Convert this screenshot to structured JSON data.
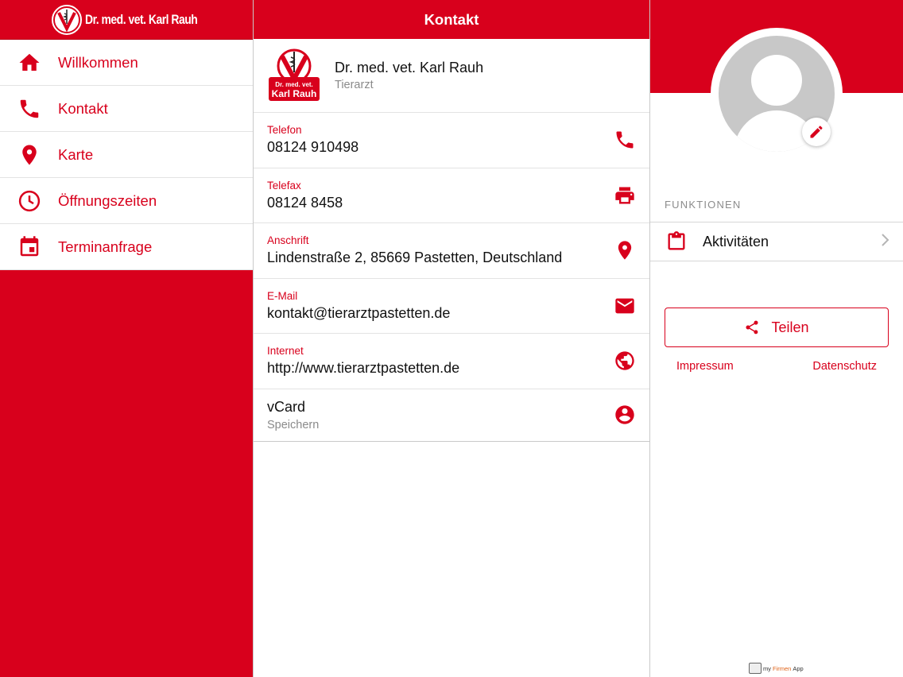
{
  "colors": {
    "brand_red": "#d8001c",
    "label_gray": "#8a8a8a",
    "divider": "#e3e3e3"
  },
  "sidebar": {
    "logo_text": "Dr. med. vet. Karl Rauh",
    "items": [
      {
        "label": "Willkommen",
        "icon": "home-icon"
      },
      {
        "label": "Kontakt",
        "icon": "phone-icon"
      },
      {
        "label": "Karte",
        "icon": "map-pin-icon"
      },
      {
        "label": "Öffnungszeiten",
        "icon": "clock-icon"
      },
      {
        "label": "Terminanfrage",
        "icon": "calendar-icon"
      }
    ]
  },
  "main": {
    "title": "Kontakt",
    "profile": {
      "name": "Dr. med. vet. Karl Rauh",
      "subtitle": "Tierarzt",
      "logo_line1": "Dr. med. vet.",
      "logo_line2": "Karl Rauh"
    },
    "rows": [
      {
        "label": "Telefon",
        "value": "08124 910498",
        "icon": "phone-icon"
      },
      {
        "label": "Telefax",
        "value": "08124 8458",
        "icon": "printer-icon"
      },
      {
        "label": "Anschrift",
        "value": "Lindenstraße 2, 85669 Pastetten, Deutschland",
        "icon": "map-pin-icon"
      },
      {
        "label": "E-Mail",
        "value": "kontakt@tierarztpastetten.de",
        "icon": "mail-icon"
      },
      {
        "label": "Internet",
        "value": "http://www.tierarztpastetten.de",
        "icon": "globe-icon"
      }
    ],
    "vcard": {
      "title": "vCard",
      "subtitle": "Speichern",
      "icon": "account-circle-icon"
    }
  },
  "right": {
    "section_title": "FUNKTIONEN",
    "function_item": {
      "label": "Aktivitäten",
      "icon": "clipboard-icon"
    },
    "share_label": "Teilen",
    "impressum": "Impressum",
    "datenschutz": "Datenschutz",
    "brand_prefix": "my",
    "brand_mid": "Firmen",
    "brand_suffix": "App"
  }
}
